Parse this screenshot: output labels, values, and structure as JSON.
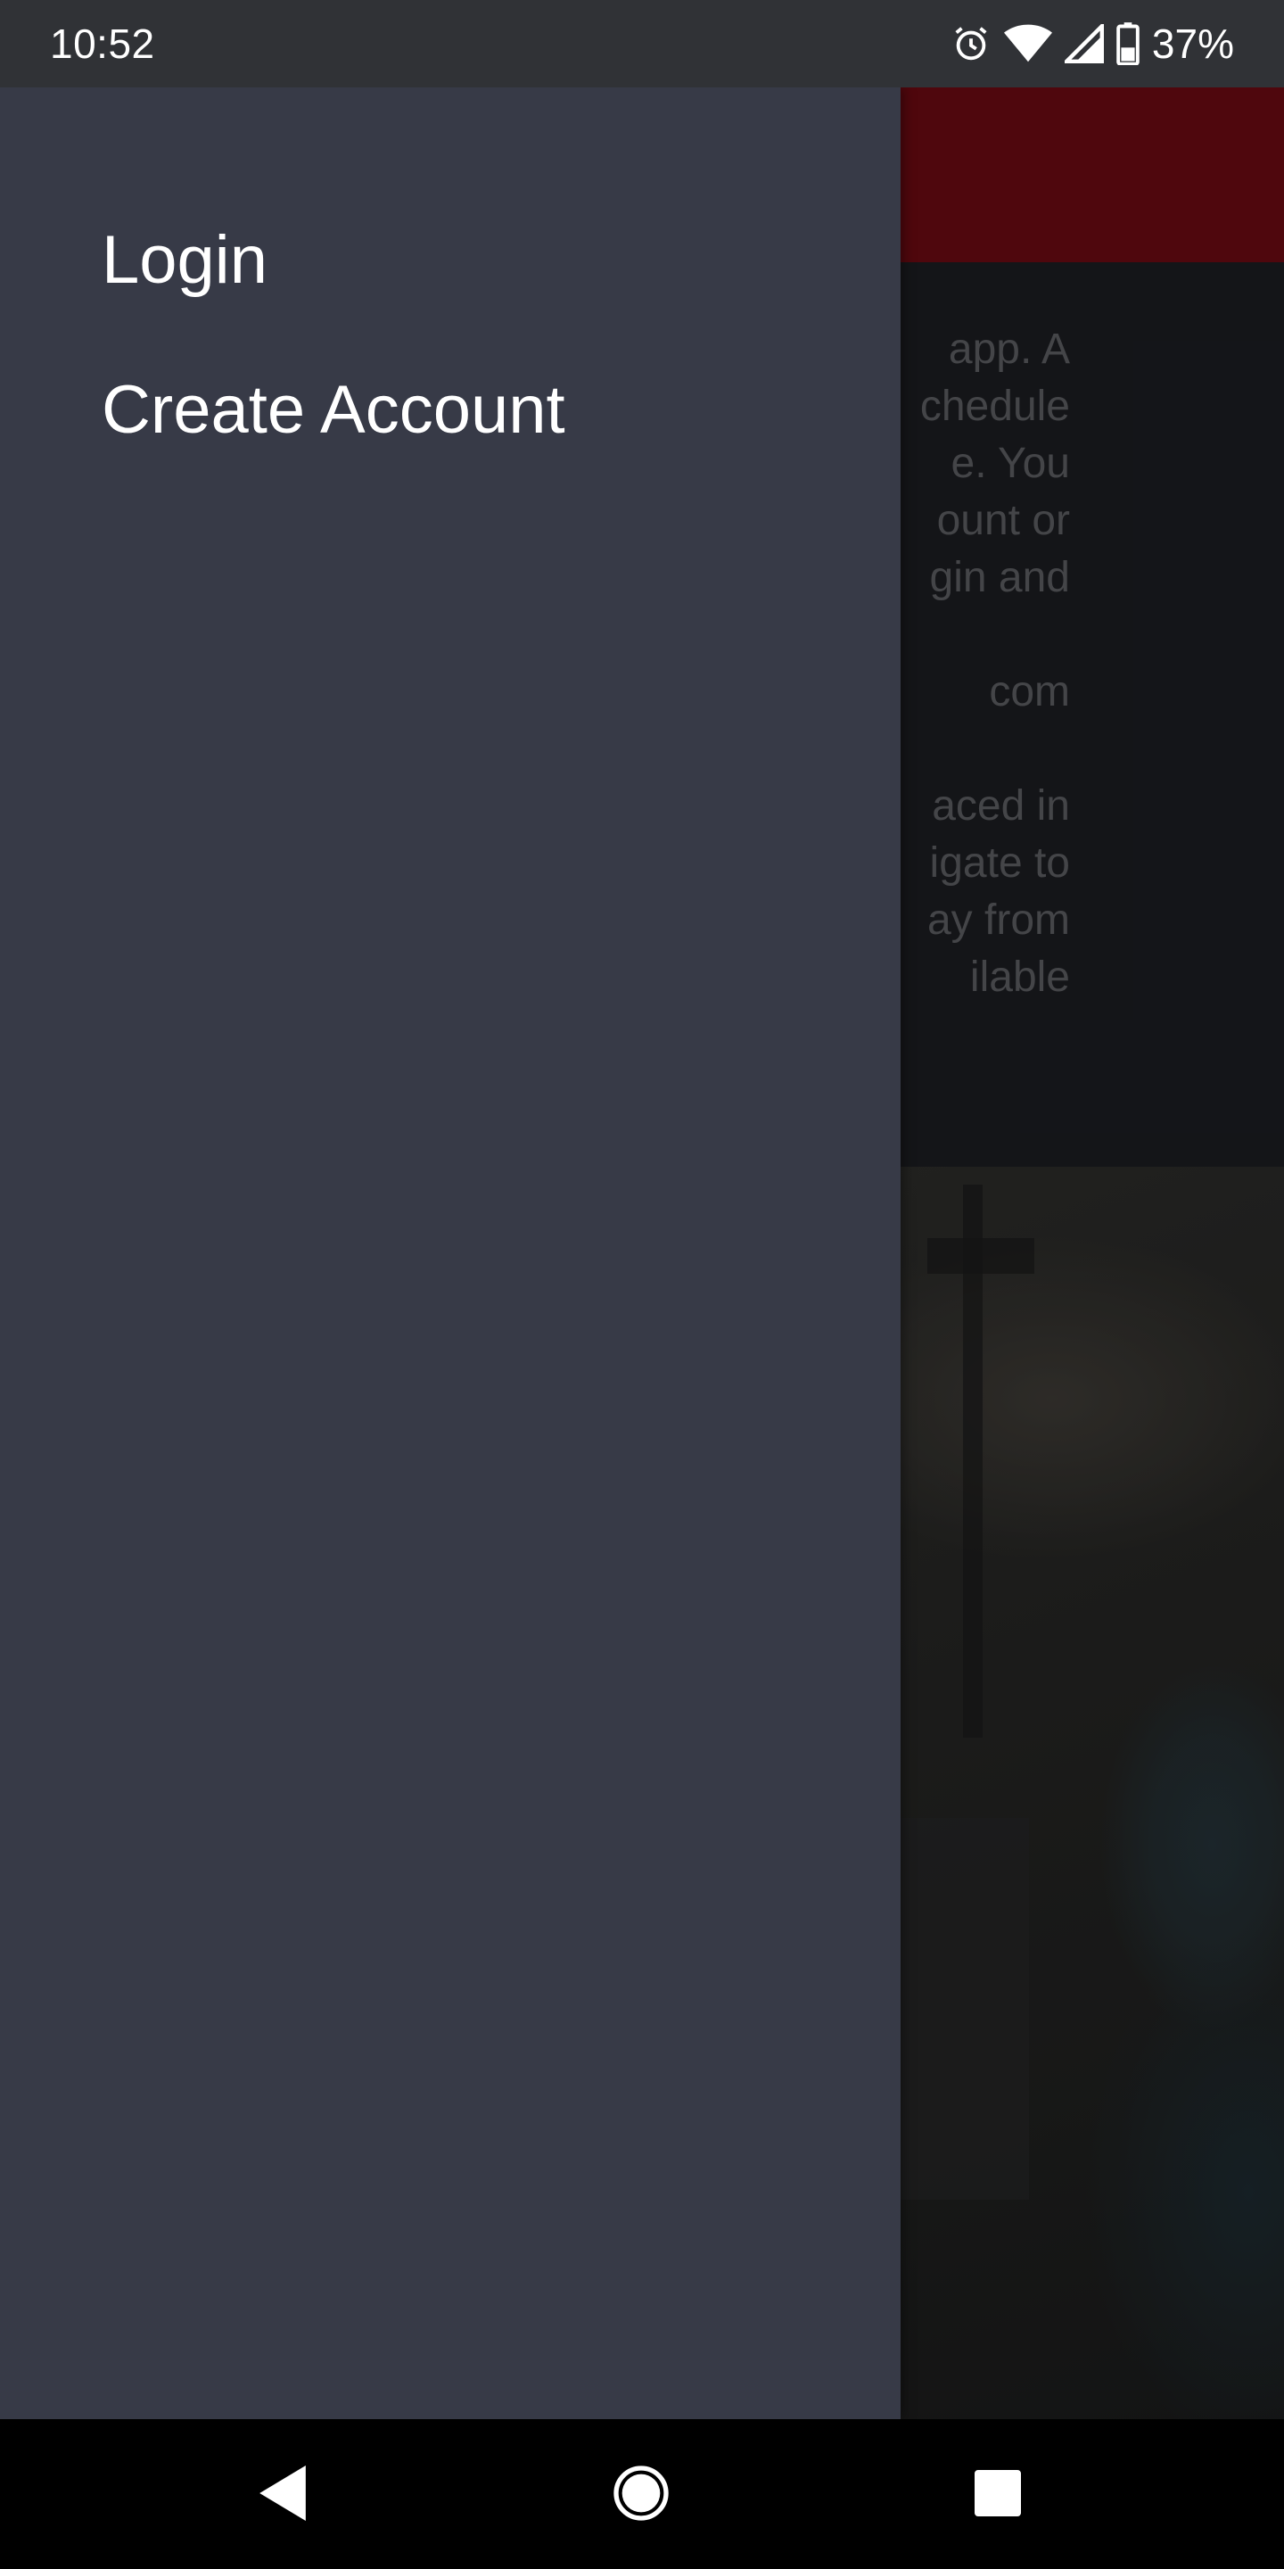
{
  "status_bar": {
    "time": "10:52",
    "battery_level": "37%",
    "icons": [
      "alarm-icon",
      "wifi-icon",
      "cell-signal-icon",
      "battery-icon"
    ]
  },
  "background": {
    "intro_paragraphs": [
      "app. A\nchedule\ne. You\nount or\ngin and",
      "com",
      "aced in\nigate to\nay from\nilable"
    ]
  },
  "drawer": {
    "items": [
      {
        "label": "Login"
      },
      {
        "label": "Create Account"
      }
    ]
  },
  "nav_bar": {
    "buttons": [
      "back-icon",
      "home-icon",
      "recents-icon"
    ]
  },
  "colors": {
    "drawer_bg": "#373a47",
    "header_accent": "#6a0a12",
    "status_bar_bg": "#303236",
    "nav_bar_bg": "#000000"
  }
}
